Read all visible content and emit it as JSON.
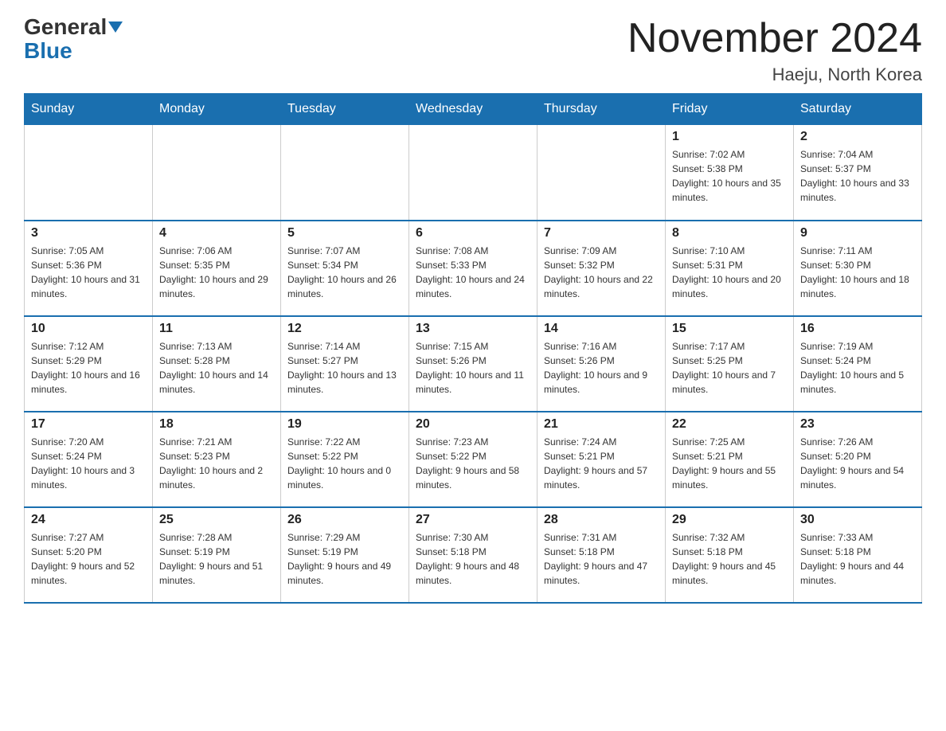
{
  "header": {
    "logo_general": "General",
    "logo_blue": "Blue",
    "month_title": "November 2024",
    "location": "Haeju, North Korea"
  },
  "days_of_week": [
    "Sunday",
    "Monday",
    "Tuesday",
    "Wednesday",
    "Thursday",
    "Friday",
    "Saturday"
  ],
  "weeks": [
    [
      {
        "day": "",
        "sunrise": "",
        "sunset": "",
        "daylight": ""
      },
      {
        "day": "",
        "sunrise": "",
        "sunset": "",
        "daylight": ""
      },
      {
        "day": "",
        "sunrise": "",
        "sunset": "",
        "daylight": ""
      },
      {
        "day": "",
        "sunrise": "",
        "sunset": "",
        "daylight": ""
      },
      {
        "day": "",
        "sunrise": "",
        "sunset": "",
        "daylight": ""
      },
      {
        "day": "1",
        "sunrise": "Sunrise: 7:02 AM",
        "sunset": "Sunset: 5:38 PM",
        "daylight": "Daylight: 10 hours and 35 minutes."
      },
      {
        "day": "2",
        "sunrise": "Sunrise: 7:04 AM",
        "sunset": "Sunset: 5:37 PM",
        "daylight": "Daylight: 10 hours and 33 minutes."
      }
    ],
    [
      {
        "day": "3",
        "sunrise": "Sunrise: 7:05 AM",
        "sunset": "Sunset: 5:36 PM",
        "daylight": "Daylight: 10 hours and 31 minutes."
      },
      {
        "day": "4",
        "sunrise": "Sunrise: 7:06 AM",
        "sunset": "Sunset: 5:35 PM",
        "daylight": "Daylight: 10 hours and 29 minutes."
      },
      {
        "day": "5",
        "sunrise": "Sunrise: 7:07 AM",
        "sunset": "Sunset: 5:34 PM",
        "daylight": "Daylight: 10 hours and 26 minutes."
      },
      {
        "day": "6",
        "sunrise": "Sunrise: 7:08 AM",
        "sunset": "Sunset: 5:33 PM",
        "daylight": "Daylight: 10 hours and 24 minutes."
      },
      {
        "day": "7",
        "sunrise": "Sunrise: 7:09 AM",
        "sunset": "Sunset: 5:32 PM",
        "daylight": "Daylight: 10 hours and 22 minutes."
      },
      {
        "day": "8",
        "sunrise": "Sunrise: 7:10 AM",
        "sunset": "Sunset: 5:31 PM",
        "daylight": "Daylight: 10 hours and 20 minutes."
      },
      {
        "day": "9",
        "sunrise": "Sunrise: 7:11 AM",
        "sunset": "Sunset: 5:30 PM",
        "daylight": "Daylight: 10 hours and 18 minutes."
      }
    ],
    [
      {
        "day": "10",
        "sunrise": "Sunrise: 7:12 AM",
        "sunset": "Sunset: 5:29 PM",
        "daylight": "Daylight: 10 hours and 16 minutes."
      },
      {
        "day": "11",
        "sunrise": "Sunrise: 7:13 AM",
        "sunset": "Sunset: 5:28 PM",
        "daylight": "Daylight: 10 hours and 14 minutes."
      },
      {
        "day": "12",
        "sunrise": "Sunrise: 7:14 AM",
        "sunset": "Sunset: 5:27 PM",
        "daylight": "Daylight: 10 hours and 13 minutes."
      },
      {
        "day": "13",
        "sunrise": "Sunrise: 7:15 AM",
        "sunset": "Sunset: 5:26 PM",
        "daylight": "Daylight: 10 hours and 11 minutes."
      },
      {
        "day": "14",
        "sunrise": "Sunrise: 7:16 AM",
        "sunset": "Sunset: 5:26 PM",
        "daylight": "Daylight: 10 hours and 9 minutes."
      },
      {
        "day": "15",
        "sunrise": "Sunrise: 7:17 AM",
        "sunset": "Sunset: 5:25 PM",
        "daylight": "Daylight: 10 hours and 7 minutes."
      },
      {
        "day": "16",
        "sunrise": "Sunrise: 7:19 AM",
        "sunset": "Sunset: 5:24 PM",
        "daylight": "Daylight: 10 hours and 5 minutes."
      }
    ],
    [
      {
        "day": "17",
        "sunrise": "Sunrise: 7:20 AM",
        "sunset": "Sunset: 5:24 PM",
        "daylight": "Daylight: 10 hours and 3 minutes."
      },
      {
        "day": "18",
        "sunrise": "Sunrise: 7:21 AM",
        "sunset": "Sunset: 5:23 PM",
        "daylight": "Daylight: 10 hours and 2 minutes."
      },
      {
        "day": "19",
        "sunrise": "Sunrise: 7:22 AM",
        "sunset": "Sunset: 5:22 PM",
        "daylight": "Daylight: 10 hours and 0 minutes."
      },
      {
        "day": "20",
        "sunrise": "Sunrise: 7:23 AM",
        "sunset": "Sunset: 5:22 PM",
        "daylight": "Daylight: 9 hours and 58 minutes."
      },
      {
        "day": "21",
        "sunrise": "Sunrise: 7:24 AM",
        "sunset": "Sunset: 5:21 PM",
        "daylight": "Daylight: 9 hours and 57 minutes."
      },
      {
        "day": "22",
        "sunrise": "Sunrise: 7:25 AM",
        "sunset": "Sunset: 5:21 PM",
        "daylight": "Daylight: 9 hours and 55 minutes."
      },
      {
        "day": "23",
        "sunrise": "Sunrise: 7:26 AM",
        "sunset": "Sunset: 5:20 PM",
        "daylight": "Daylight: 9 hours and 54 minutes."
      }
    ],
    [
      {
        "day": "24",
        "sunrise": "Sunrise: 7:27 AM",
        "sunset": "Sunset: 5:20 PM",
        "daylight": "Daylight: 9 hours and 52 minutes."
      },
      {
        "day": "25",
        "sunrise": "Sunrise: 7:28 AM",
        "sunset": "Sunset: 5:19 PM",
        "daylight": "Daylight: 9 hours and 51 minutes."
      },
      {
        "day": "26",
        "sunrise": "Sunrise: 7:29 AM",
        "sunset": "Sunset: 5:19 PM",
        "daylight": "Daylight: 9 hours and 49 minutes."
      },
      {
        "day": "27",
        "sunrise": "Sunrise: 7:30 AM",
        "sunset": "Sunset: 5:18 PM",
        "daylight": "Daylight: 9 hours and 48 minutes."
      },
      {
        "day": "28",
        "sunrise": "Sunrise: 7:31 AM",
        "sunset": "Sunset: 5:18 PM",
        "daylight": "Daylight: 9 hours and 47 minutes."
      },
      {
        "day": "29",
        "sunrise": "Sunrise: 7:32 AM",
        "sunset": "Sunset: 5:18 PM",
        "daylight": "Daylight: 9 hours and 45 minutes."
      },
      {
        "day": "30",
        "sunrise": "Sunrise: 7:33 AM",
        "sunset": "Sunset: 5:18 PM",
        "daylight": "Daylight: 9 hours and 44 minutes."
      }
    ]
  ]
}
